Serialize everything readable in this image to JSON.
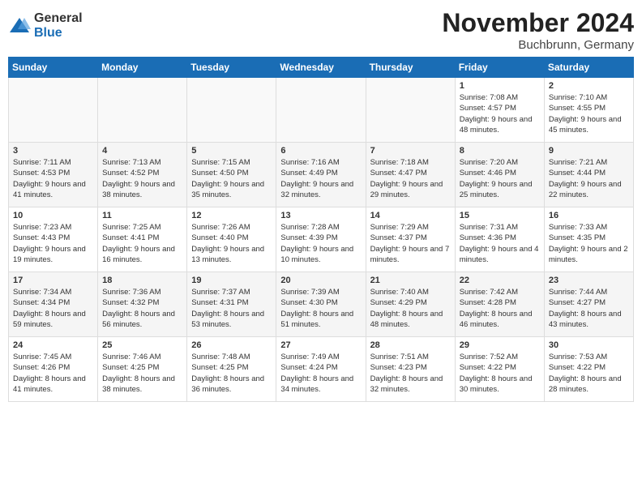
{
  "logo": {
    "general": "General",
    "blue": "Blue"
  },
  "title": "November 2024",
  "location": "Buchbrunn, Germany",
  "days_of_week": [
    "Sunday",
    "Monday",
    "Tuesday",
    "Wednesday",
    "Thursday",
    "Friday",
    "Saturday"
  ],
  "weeks": [
    [
      {
        "day": "",
        "info": ""
      },
      {
        "day": "",
        "info": ""
      },
      {
        "day": "",
        "info": ""
      },
      {
        "day": "",
        "info": ""
      },
      {
        "day": "",
        "info": ""
      },
      {
        "day": "1",
        "info": "Sunrise: 7:08 AM\nSunset: 4:57 PM\nDaylight: 9 hours and 48 minutes."
      },
      {
        "day": "2",
        "info": "Sunrise: 7:10 AM\nSunset: 4:55 PM\nDaylight: 9 hours and 45 minutes."
      }
    ],
    [
      {
        "day": "3",
        "info": "Sunrise: 7:11 AM\nSunset: 4:53 PM\nDaylight: 9 hours and 41 minutes."
      },
      {
        "day": "4",
        "info": "Sunrise: 7:13 AM\nSunset: 4:52 PM\nDaylight: 9 hours and 38 minutes."
      },
      {
        "day": "5",
        "info": "Sunrise: 7:15 AM\nSunset: 4:50 PM\nDaylight: 9 hours and 35 minutes."
      },
      {
        "day": "6",
        "info": "Sunrise: 7:16 AM\nSunset: 4:49 PM\nDaylight: 9 hours and 32 minutes."
      },
      {
        "day": "7",
        "info": "Sunrise: 7:18 AM\nSunset: 4:47 PM\nDaylight: 9 hours and 29 minutes."
      },
      {
        "day": "8",
        "info": "Sunrise: 7:20 AM\nSunset: 4:46 PM\nDaylight: 9 hours and 25 minutes."
      },
      {
        "day": "9",
        "info": "Sunrise: 7:21 AM\nSunset: 4:44 PM\nDaylight: 9 hours and 22 minutes."
      }
    ],
    [
      {
        "day": "10",
        "info": "Sunrise: 7:23 AM\nSunset: 4:43 PM\nDaylight: 9 hours and 19 minutes."
      },
      {
        "day": "11",
        "info": "Sunrise: 7:25 AM\nSunset: 4:41 PM\nDaylight: 9 hours and 16 minutes."
      },
      {
        "day": "12",
        "info": "Sunrise: 7:26 AM\nSunset: 4:40 PM\nDaylight: 9 hours and 13 minutes."
      },
      {
        "day": "13",
        "info": "Sunrise: 7:28 AM\nSunset: 4:39 PM\nDaylight: 9 hours and 10 minutes."
      },
      {
        "day": "14",
        "info": "Sunrise: 7:29 AM\nSunset: 4:37 PM\nDaylight: 9 hours and 7 minutes."
      },
      {
        "day": "15",
        "info": "Sunrise: 7:31 AM\nSunset: 4:36 PM\nDaylight: 9 hours and 4 minutes."
      },
      {
        "day": "16",
        "info": "Sunrise: 7:33 AM\nSunset: 4:35 PM\nDaylight: 9 hours and 2 minutes."
      }
    ],
    [
      {
        "day": "17",
        "info": "Sunrise: 7:34 AM\nSunset: 4:34 PM\nDaylight: 8 hours and 59 minutes."
      },
      {
        "day": "18",
        "info": "Sunrise: 7:36 AM\nSunset: 4:32 PM\nDaylight: 8 hours and 56 minutes."
      },
      {
        "day": "19",
        "info": "Sunrise: 7:37 AM\nSunset: 4:31 PM\nDaylight: 8 hours and 53 minutes."
      },
      {
        "day": "20",
        "info": "Sunrise: 7:39 AM\nSunset: 4:30 PM\nDaylight: 8 hours and 51 minutes."
      },
      {
        "day": "21",
        "info": "Sunrise: 7:40 AM\nSunset: 4:29 PM\nDaylight: 8 hours and 48 minutes."
      },
      {
        "day": "22",
        "info": "Sunrise: 7:42 AM\nSunset: 4:28 PM\nDaylight: 8 hours and 46 minutes."
      },
      {
        "day": "23",
        "info": "Sunrise: 7:44 AM\nSunset: 4:27 PM\nDaylight: 8 hours and 43 minutes."
      }
    ],
    [
      {
        "day": "24",
        "info": "Sunrise: 7:45 AM\nSunset: 4:26 PM\nDaylight: 8 hours and 41 minutes."
      },
      {
        "day": "25",
        "info": "Sunrise: 7:46 AM\nSunset: 4:25 PM\nDaylight: 8 hours and 38 minutes."
      },
      {
        "day": "26",
        "info": "Sunrise: 7:48 AM\nSunset: 4:25 PM\nDaylight: 8 hours and 36 minutes."
      },
      {
        "day": "27",
        "info": "Sunrise: 7:49 AM\nSunset: 4:24 PM\nDaylight: 8 hours and 34 minutes."
      },
      {
        "day": "28",
        "info": "Sunrise: 7:51 AM\nSunset: 4:23 PM\nDaylight: 8 hours and 32 minutes."
      },
      {
        "day": "29",
        "info": "Sunrise: 7:52 AM\nSunset: 4:22 PM\nDaylight: 8 hours and 30 minutes."
      },
      {
        "day": "30",
        "info": "Sunrise: 7:53 AM\nSunset: 4:22 PM\nDaylight: 8 hours and 28 minutes."
      }
    ]
  ]
}
